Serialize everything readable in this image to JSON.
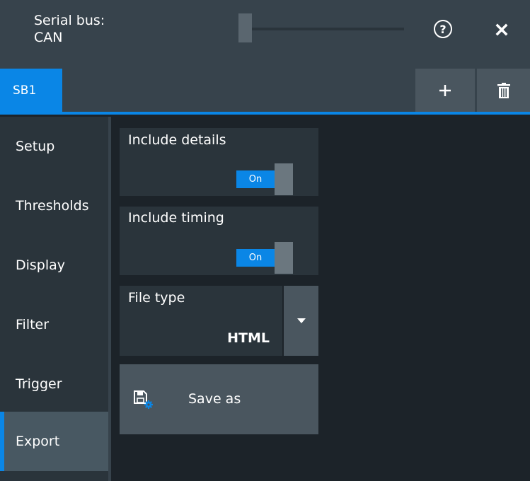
{
  "header": {
    "title_line1": "Serial bus:",
    "title_line2": "CAN",
    "help_icon": "question-circle-icon",
    "close_icon": "close-icon"
  },
  "tabs": {
    "active_tab": "SB1",
    "add_icon": "plus-icon",
    "delete_icon": "trash-icon"
  },
  "sidebar": {
    "items": [
      {
        "label": "Setup"
      },
      {
        "label": "Thresholds"
      },
      {
        "label": "Display"
      },
      {
        "label": "Filter"
      },
      {
        "label": "Trigger"
      },
      {
        "label": "Export",
        "active": true
      }
    ]
  },
  "export": {
    "include_details": {
      "label": "Include details",
      "state": "On"
    },
    "include_timing": {
      "label": "Include timing",
      "state": "On"
    },
    "file_type": {
      "label": "File type",
      "value": "HTML"
    },
    "save_as": {
      "label": "Save as",
      "icon": "save-icon"
    }
  },
  "colors": {
    "accent": "#0a86e6",
    "header_bg": "#37434c",
    "panel_bg": "#2a343b",
    "button_bg": "#4a565f",
    "page_bg": "#1c2329"
  }
}
